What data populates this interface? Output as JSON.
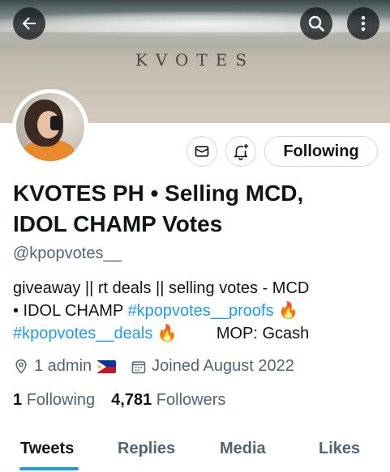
{
  "banner": {
    "title": "KVOTES"
  },
  "header": {
    "back_icon": "arrow-left-icon",
    "search_icon": "search-icon",
    "more_icon": "more-vertical-icon"
  },
  "actions": {
    "message_icon": "envelope-icon",
    "notify_icon": "bell-plus-icon",
    "follow_label": "Following"
  },
  "profile": {
    "name_line1": "KVOTES PH • Selling MCD,",
    "name_line2": "IDOL CHAMP Votes",
    "handle": "@kpopvotes__",
    "bio_line1": "giveaway || rt deals || selling votes -  MCD",
    "bio_line2_text": "• IDOL CHAMP ",
    "bio_tag1": "#kpopvotes__proofs",
    "bio_fire1": " 🔥",
    "bio_tag2": "#kpopvotes__deals",
    "bio_fire2": " 🔥",
    "bio_mop": "MOP: Gcash",
    "location": "1 admin",
    "joined": "Joined August 2022",
    "following_count": "1",
    "following_label": "Following",
    "followers_count": "4,781",
    "followers_label": "Followers"
  },
  "tabs": [
    "Tweets",
    "Replies",
    "Media",
    "Likes"
  ],
  "colors": {
    "accent": "#1d9bf0",
    "text": "#0f1419",
    "muted": "#536471"
  }
}
